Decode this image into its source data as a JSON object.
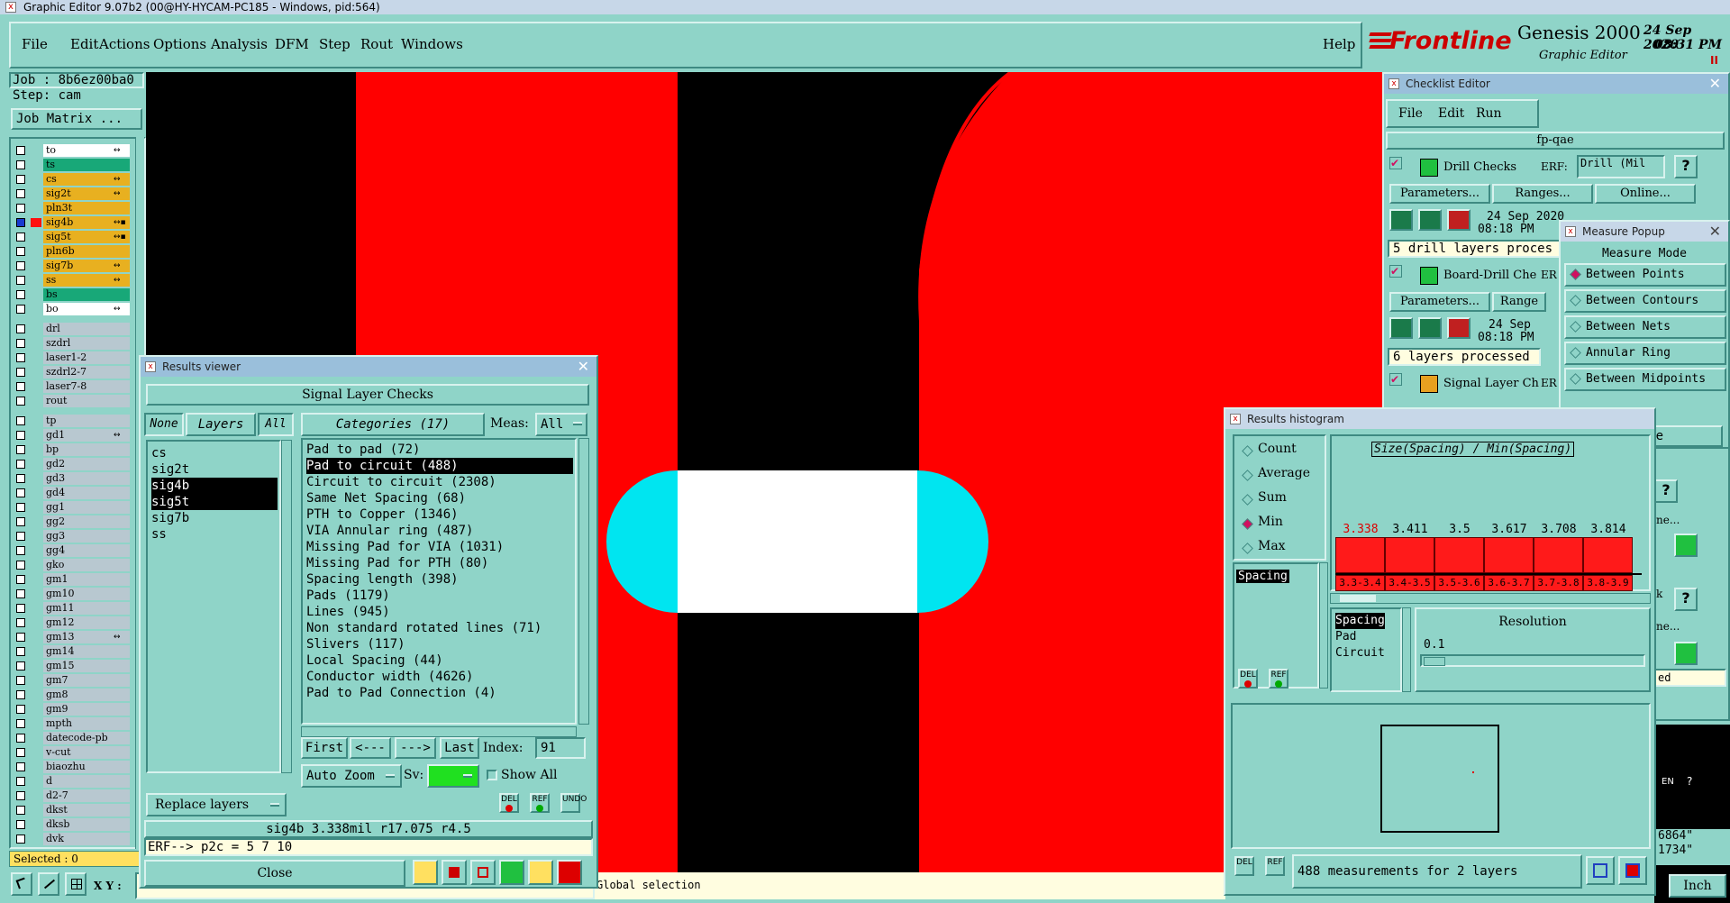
{
  "app": {
    "title": "Graphic Editor 9.07b2 (00@HY-HYCAM-PC185 - Windows, pid:564)"
  },
  "menu": [
    "File",
    "Edit",
    "Actions",
    "Options",
    "Analysis",
    "DFM",
    "Step",
    "Rout",
    "Windows"
  ],
  "help_label": "Help",
  "brand": {
    "logo": "Frontline",
    "product": "Genesis 2000",
    "subtitle": "Graphic Editor",
    "date": "24 Sep 2020",
    "time": "08:31 PM",
    "pause": "II"
  },
  "job": {
    "job_label": "Job : 8b6ez00ba0",
    "step_label": "Step: cam",
    "matrix_button": "Job Matrix ..."
  },
  "layers": [
    {
      "name": "to",
      "color": "#ffffff",
      "flag": "↔"
    },
    {
      "name": "ts",
      "color": "#18a878",
      "flag": ""
    },
    {
      "name": "cs",
      "color": "#e8b020",
      "flag": "↔"
    },
    {
      "name": "sig2t",
      "color": "#e8b020",
      "flag": "↔"
    },
    {
      "name": "pln3t",
      "color": "#e8b020",
      "flag": ""
    },
    {
      "name": "sig4b",
      "color": "#e8b020",
      "flag": "↔▪",
      "active": true
    },
    {
      "name": "sig5t",
      "color": "#e8b020",
      "flag": "↔▪"
    },
    {
      "name": "pln6b",
      "color": "#e8b020",
      "flag": ""
    },
    {
      "name": "sig7b",
      "color": "#e8b020",
      "flag": "↔"
    },
    {
      "name": "ss",
      "color": "#e8b020",
      "flag": "↔"
    },
    {
      "name": "bs",
      "color": "#18a878",
      "flag": ""
    },
    {
      "name": "bo",
      "color": "#ffffff",
      "flag": "↔"
    }
  ],
  "layers2": [
    "drl",
    "szdrl",
    "laser1-2",
    "szdrl2-7",
    "laser7-8",
    "rout"
  ],
  "layers3": [
    {
      "name": "tp",
      "flag": ""
    },
    {
      "name": "gd1",
      "flag": "↔"
    },
    {
      "name": "bp",
      "flag": ""
    },
    {
      "name": "gd2",
      "flag": ""
    },
    {
      "name": "gd3",
      "flag": ""
    },
    {
      "name": "gd4",
      "flag": ""
    },
    {
      "name": "gg1",
      "flag": ""
    },
    {
      "name": "gg2",
      "flag": ""
    },
    {
      "name": "gg3",
      "flag": ""
    },
    {
      "name": "gg4",
      "flag": ""
    },
    {
      "name": "gko",
      "flag": ""
    },
    {
      "name": "gm1",
      "flag": ""
    },
    {
      "name": "gm10",
      "flag": ""
    },
    {
      "name": "gm11",
      "flag": ""
    },
    {
      "name": "gm12",
      "flag": ""
    },
    {
      "name": "gm13",
      "flag": "↔"
    },
    {
      "name": "gm14",
      "flag": ""
    },
    {
      "name": "gm15",
      "flag": ""
    },
    {
      "name": "gm7",
      "flag": ""
    },
    {
      "name": "gm8",
      "flag": ""
    },
    {
      "name": "gm9",
      "flag": ""
    },
    {
      "name": "mpth",
      "flag": ""
    },
    {
      "name": "datecode-pb",
      "flag": ""
    },
    {
      "name": "v-cut",
      "flag": ""
    },
    {
      "name": "biaozhu",
      "flag": ""
    },
    {
      "name": "d",
      "flag": ""
    },
    {
      "name": "d2-7",
      "flag": ""
    },
    {
      "name": "dkst",
      "flag": ""
    },
    {
      "name": "dksb",
      "flag": ""
    },
    {
      "name": "dvk",
      "flag": ""
    }
  ],
  "selected_label": "Selected : 0",
  "xy_label": "X Y :",
  "status_hint": "Global selection",
  "results_viewer": {
    "title": "Results viewer",
    "header": "Signal Layer Checks",
    "none": "None",
    "layers_btn": "Layers",
    "all": "All",
    "categories_btn": "Categories (17)",
    "meas_label": "Meas:",
    "meas_value": "All",
    "layer_list": [
      "cs",
      "sig2t",
      "sig4b",
      "sig5t",
      "sig7b",
      "ss"
    ],
    "layer_selected": [
      "sig4b",
      "sig5t"
    ],
    "categories": [
      "Pad to pad (72)",
      "Pad to circuit (488)",
      "Circuit to circuit (2308)",
      "Same Net Spacing (68)",
      "PTH to Copper (1346)",
      "VIA Annular ring (487)",
      "Missing Pad for VIA (1031)",
      "Missing Pad for PTH (80)",
      "Spacing length (398)",
      "Pads (1179)",
      "Lines (945)",
      "Non standard rotated lines (71)",
      "Slivers (117)",
      "Local Spacing (44)",
      "Conductor width (4626)",
      "Pad to Pad Connection (4)"
    ],
    "category_selected": "Pad to circuit (488)",
    "first": "First",
    "prev": "<---",
    "next": "--->",
    "last": "Last",
    "index_label": "Index:",
    "index_value": "91",
    "autozoom": "Auto Zoom",
    "sv_label": "Sv:",
    "show_all": "Show All",
    "replace_layers": "Replace layers",
    "del": "DEL",
    "ref": "REF",
    "undo": "UNDO",
    "measurement": "sig4b 3.338mil  r17.075  r4.5",
    "erf_line": "ERF--> p2c = 5 7 10",
    "close": "Close"
  },
  "checklist": {
    "title": "Checklist Editor",
    "menu": [
      "File",
      "Edit",
      "Run"
    ],
    "name": "fp-qae",
    "checks": [
      {
        "name": "Drill Checks",
        "erf_label": "ERF:",
        "erf_value": "Drill (Mil",
        "params": "Parameters...",
        "ranges": "Ranges...",
        "online": "Online...",
        "date": "24 Sep 2020",
        "time": "08:18 PM",
        "status": "5 drill layers proces"
      },
      {
        "name": "Board-Drill Che",
        "erf_label": "ER",
        "params": "Parameters...",
        "ranges": "Range",
        "date": "24 Sep",
        "time": "08:18 PM",
        "status": "6 layers processed"
      },
      {
        "name": "Signal Layer Ch",
        "erf_label": "ER"
      }
    ]
  },
  "measure_popup": {
    "title": "Measure Popup",
    "header": "Measure Mode",
    "modes": [
      "Between Points",
      "Between Contours",
      "Between Nets",
      "Annular Ring",
      "Between Midpoints"
    ],
    "active": "Between Points",
    "close": "Close"
  },
  "histogram": {
    "title": "Results histogram",
    "options": [
      "Count",
      "Average",
      "Sum",
      "Min",
      "Max"
    ],
    "active": "Min",
    "list_item": "Spacing",
    "del": "DEL",
    "ref": "REF",
    "ylabel": "Size(Spacing) / Min(Spacing)",
    "top_labels": [
      "3.338",
      "3.411",
      "3.5",
      "3.617",
      "3.708",
      "3.814"
    ],
    "bins": [
      "3.3-3.4",
      "3.4-3.5",
      "3.5-3.6",
      "3.6-3.7",
      "3.7-3.8",
      "3.8-3.9"
    ],
    "fields": [
      "Spacing",
      "Pad",
      "Circuit"
    ],
    "resolution_label": "Resolution",
    "resolution_value": "0.1",
    "summary": "488 measurements for 2 layers",
    "colors": {
      "bar": "#ff1a1a",
      "highlight": "#ff1a1a"
    }
  },
  "side_fragments": {
    "lang": "EN",
    "coord1": "6864\"",
    "coord2": "1734\"",
    "units": "Inch",
    "ne": "ne...",
    "k": "k",
    "ed": "ed"
  },
  "colors": {
    "panel": "#8fd4c8",
    "canvas": "#000000",
    "copper": "#ff0000",
    "pad_fill": "#ffffff",
    "pad_cap": "#00e5f0"
  }
}
